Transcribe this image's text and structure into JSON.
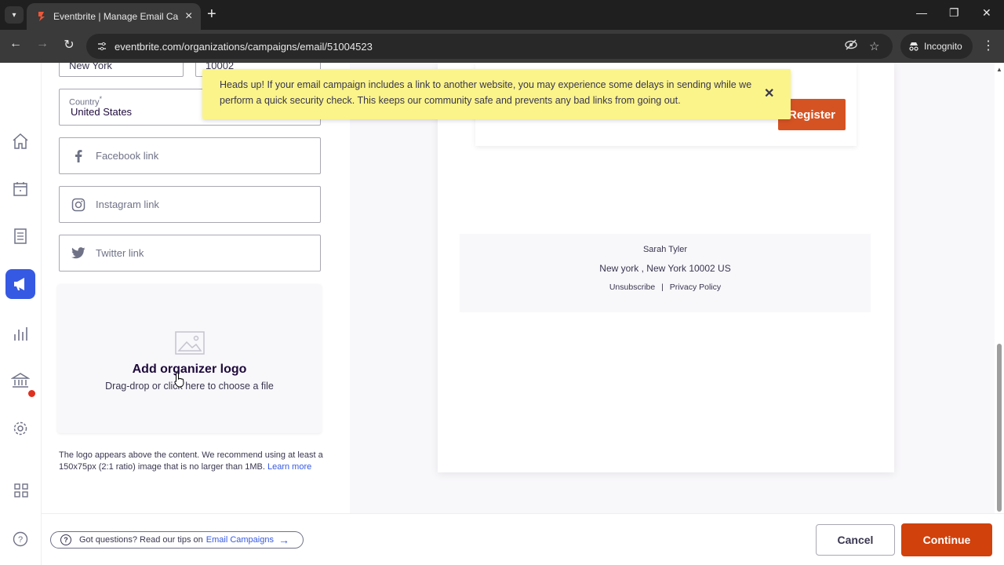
{
  "browser": {
    "tab_title": "Eventbrite | Manage Email Campaigns",
    "url": "eventbrite.com/organizations/campaigns/email/51004523",
    "incognito_label": "Incognito"
  },
  "form": {
    "city_value": "New York",
    "zip_value": "10002",
    "country_label": "Country",
    "country_required_mark": "*",
    "country_value": "United States",
    "facebook_placeholder": "Facebook link",
    "instagram_placeholder": "Instagram link",
    "twitter_placeholder": "Twitter link"
  },
  "logo_upload": {
    "title": "Add organizer logo",
    "subtitle": "Drag-drop or click here to choose a file",
    "hint": "The logo appears above the content. We recommend using at least a 150x75px (2:1 ratio) image that is no larger than 1MB.",
    "learn_more": "Learn more"
  },
  "toast": {
    "message": "Heads up! If your email campaign includes a link to another website, you may experience some delays in sending while we perform a quick security check. This keeps our community safe and prevents any bad links from going out."
  },
  "preview": {
    "register_label": "Register",
    "organizer_name": "Sarah Tyler",
    "address": "New york , New York 10002 US",
    "unsubscribe": "Unsubscribe",
    "separator": "|",
    "privacy": "Privacy Policy"
  },
  "footer": {
    "help_text": "Got questions? Read our tips on",
    "help_link": "Email Campaigns",
    "cancel_label": "Cancel",
    "continue_label": "Continue"
  },
  "colors": {
    "accent": "#3659e3",
    "brand_orange": "#d1410c",
    "toast_bg": "#fbf48a"
  }
}
